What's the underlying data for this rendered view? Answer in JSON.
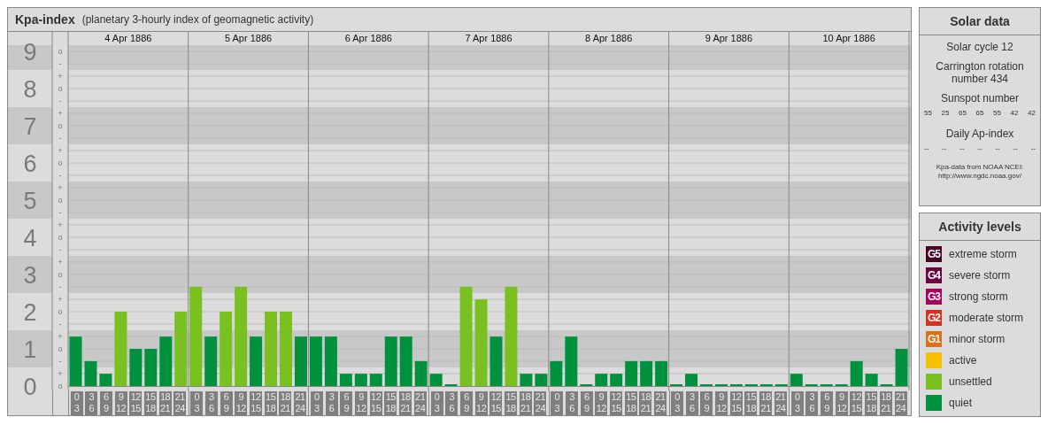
{
  "y_marks": [
    [
      "o",
      "-"
    ],
    [
      "+",
      "o",
      "-"
    ],
    [
      "+",
      "o",
      "-"
    ],
    [
      "+",
      "o",
      "-"
    ],
    [
      "+",
      "o",
      "-"
    ],
    [
      "+",
      "o",
      "-"
    ],
    [
      "+",
      "o",
      "-"
    ],
    [
      "+",
      "o",
      "-"
    ],
    [
      "+",
      "o",
      "-"
    ],
    [
      "+",
      "o"
    ]
  ],
  "days": [
    {
      "date": "4 Apr 1886",
      "slots": [
        [
          "0",
          "3"
        ],
        [
          "3",
          "6"
        ],
        [
          "6",
          "9"
        ],
        [
          "9",
          "12"
        ],
        [
          "12",
          "15"
        ],
        [
          "15",
          "18"
        ],
        [
          "18",
          "21"
        ],
        [
          "21",
          "24"
        ]
      ]
    },
    {
      "date": "5 Apr 1886",
      "slots": [
        [
          "0",
          "3"
        ],
        [
          "3",
          "6"
        ],
        [
          "6",
          "9"
        ],
        [
          "9",
          "12"
        ],
        [
          "12",
          "15"
        ],
        [
          "15",
          "18"
        ],
        [
          "18",
          "21"
        ],
        [
          "21",
          "24"
        ]
      ]
    },
    {
      "date": "6 Apr 1886",
      "slots": [
        [
          "0",
          "3"
        ],
        [
          "3",
          "6"
        ],
        [
          "6",
          "9"
        ],
        [
          "9",
          "12"
        ],
        [
          "12",
          "15"
        ],
        [
          "15",
          "18"
        ],
        [
          "18",
          "21"
        ],
        [
          "21",
          "24"
        ]
      ]
    },
    {
      "date": "7 Apr 1886",
      "slots": [
        [
          "0",
          "3"
        ],
        [
          "3",
          "6"
        ],
        [
          "6",
          "9"
        ],
        [
          "9",
          "12"
        ],
        [
          "12",
          "15"
        ],
        [
          "15",
          "18"
        ],
        [
          "18",
          "21"
        ],
        [
          "21",
          "24"
        ]
      ]
    },
    {
      "date": "8 Apr 1886",
      "slots": [
        [
          "0",
          "3"
        ],
        [
          "3",
          "6"
        ],
        [
          "6",
          "9"
        ],
        [
          "9",
          "12"
        ],
        [
          "12",
          "15"
        ],
        [
          "15",
          "18"
        ],
        [
          "18",
          "21"
        ],
        [
          "21",
          "24"
        ]
      ]
    },
    {
      "date": "9 Apr 1886",
      "slots": [
        [
          "0",
          "3"
        ],
        [
          "3",
          "6"
        ],
        [
          "6",
          "9"
        ],
        [
          "9",
          "12"
        ],
        [
          "12",
          "15"
        ],
        [
          "15",
          "18"
        ],
        [
          "18",
          "21"
        ],
        [
          "21",
          "24"
        ]
      ]
    },
    {
      "date": "10 Apr 1886",
      "slots": [
        [
          "0",
          "3"
        ],
        [
          "3",
          "6"
        ],
        [
          "6",
          "9"
        ],
        [
          "9",
          "12"
        ],
        [
          "12",
          "15"
        ],
        [
          "15",
          "18"
        ],
        [
          "18",
          "21"
        ],
        [
          "21",
          "24"
        ]
      ]
    }
  ],
  "chart_data": {
    "type": "bar",
    "title": "Kpa-index",
    "subtitle": "(planetary 3-hourly index of geomagnetic activity)",
    "ylim": [
      0,
      9.55
    ],
    "yticks": [
      0,
      1,
      2,
      3,
      4,
      5,
      6,
      7,
      8,
      9
    ],
    "grid": true,
    "values": [
      1.33,
      0.67,
      0.33,
      2,
      1,
      1,
      1.33,
      2,
      2.67,
      1.33,
      2,
      2.67,
      1.33,
      2,
      2,
      1.33,
      1.33,
      1.33,
      0.33,
      0.33,
      0.33,
      1.33,
      1.33,
      0.67,
      0.33,
      0,
      2.67,
      2.33,
      1.33,
      2.67,
      0.33,
      0.33,
      0.67,
      1.33,
      0,
      0.33,
      0.33,
      0.67,
      0.67,
      0.67,
      0,
      0.33,
      0,
      0,
      0,
      0,
      0,
      0,
      0.33,
      0,
      0,
      0,
      0.67,
      0.33,
      0,
      1
    ]
  },
  "solar_data": {
    "title": "Solar data",
    "cycle": "Solar cycle 12",
    "carrington": "Carrington rotation number 434",
    "sunspot_label": "Sunspot number",
    "sunspots": [
      "55",
      "25",
      "65",
      "65",
      "55",
      "42",
      "42"
    ],
    "ap_label": "Daily Ap-index",
    "ap_values": [
      "--",
      "--",
      "--",
      "--",
      "--",
      "--",
      "--"
    ],
    "source": "Kpa-data from NOAA NCEI:",
    "source_url": "http://www.ngdc.noaa.gov/"
  },
  "activity_levels": {
    "title": "Activity levels",
    "items": [
      {
        "badge": "G5",
        "label": "extreme storm",
        "color": "#4a0024"
      },
      {
        "badge": "G4",
        "label": "severe storm",
        "color": "#6e0040"
      },
      {
        "badge": "G3",
        "label": "strong storm",
        "color": "#a8005c"
      },
      {
        "badge": "G2",
        "label": "moderate storm",
        "color": "#d93020"
      },
      {
        "badge": "G1",
        "label": "minor storm",
        "color": "#e07018"
      },
      {
        "label": "active",
        "color": "#f5c000"
      },
      {
        "label": "unsettled",
        "color": "#7ac020"
      },
      {
        "label": "quiet",
        "color": "#00913f"
      }
    ]
  }
}
